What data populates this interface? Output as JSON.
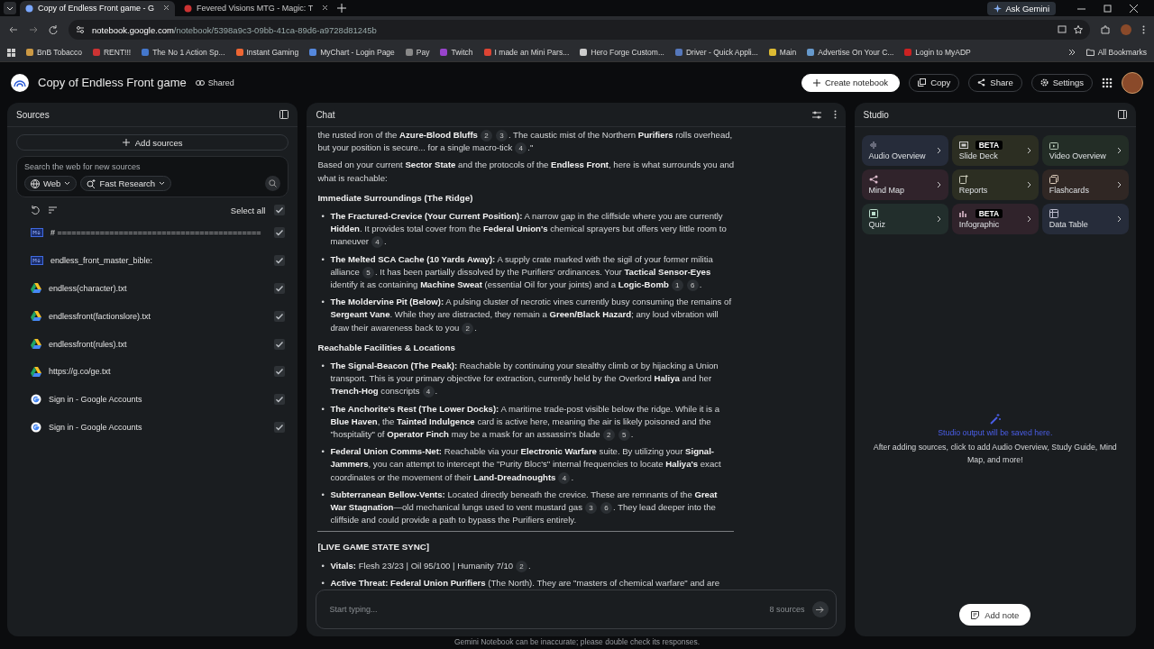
{
  "browser": {
    "tabs": [
      {
        "label": "Copy of Endless Front game - G",
        "selected": true
      },
      {
        "label": "Fevered Visions MTG - Magic: T",
        "selected": false
      }
    ],
    "ask_gemini": "Ask Gemini",
    "address": "notebook.google.com/notebook/5398a9c3-09bb-41ca-89d6-a9728d81245b",
    "bookmarks": [
      "BnB Tobacco",
      "RENT!!!",
      "The No 1 Action Sp...",
      "Instant Gaming",
      "MyChart - Login Page",
      "Pay",
      "Twitch",
      "I made an Mini Pars...",
      "Hero Forge Custom...",
      "Driver - Quick Appli...",
      "Main",
      "Advertise On Your C...",
      "Login to MyADP"
    ],
    "all_bookmarks": "All Bookmarks"
  },
  "header": {
    "title": "Copy of Endless Front game",
    "shared": "Shared",
    "actions": [
      "Create notebook",
      "Copy",
      "Share",
      "Settings"
    ]
  },
  "sources": {
    "title": "Sources",
    "add": "Add sources",
    "search_placeholder": "Search the web for new sources",
    "web": "Web",
    "research": "Fast Research",
    "select_all": {
      "label": "Select all",
      "checked": true
    },
    "items": [
      {
        "kind": "markdown",
        "name": "# ===========================================",
        "checked": true
      },
      {
        "kind": "markdown",
        "name": "endless_front_master_bible:",
        "checked": true
      },
      {
        "kind": "drive",
        "name": "endless(character).txt",
        "checked": true
      },
      {
        "kind": "drive",
        "name": "endlessfront(factionslore).txt",
        "checked": true
      },
      {
        "kind": "drive",
        "name": "endlessfront(rules).txt",
        "checked": true
      },
      {
        "kind": "drive",
        "name": "https://g.co/ge.txt",
        "checked": true
      },
      {
        "kind": "web",
        "name": "Sign in - Google Accounts",
        "checked": true
      },
      {
        "kind": "web",
        "name": "Sign in - Google Accounts",
        "checked": true
      }
    ]
  },
  "chat": {
    "title": "Chat",
    "blocks": [
      {
        "kind": "para",
        "segments": [
          {
            "text": "the rusted iron of the **Azure-Blood Bluffs**"
          },
          {
            "cite": "2"
          },
          {
            "cite": "3"
          },
          {
            "text": ". The caustic mist of the Northern **Purifiers** rolls overhead, but your position is secure... for a single macro-tick"
          },
          {
            "cite": "4"
          },
          {
            "text": ".\""
          }
        ]
      },
      {
        "kind": "para",
        "segments": [
          {
            "text": "Based on your current **Sector State** and the protocols of the **Endless Front**, here is what surrounds you and what is reachable:"
          }
        ]
      },
      {
        "kind": "heading",
        "text": "Immediate Surroundings (The Ridge)"
      },
      {
        "kind": "bullets",
        "marker": "•",
        "items": [
          [
            {
              "text": "**The Fractured-Crevice (Your Current Position):** A narrow gap in the cliffside where you are currently **Hidden**. It provides total cover from the **Federal Union's** chemical sprayers but offers very little room to maneuver"
            },
            {
              "cite": "4"
            },
            {
              "text": "."
            }
          ],
          [
            {
              "text": "**The Melted SCA Cache (10 Yards Away):** A supply crate marked with the sigil of your former militia alliance"
            },
            {
              "cite": "5"
            },
            {
              "text": ". It has been partially dissolved by the Purifiers' ordinances. Your **Tactical Sensor-Eyes** identify it as containing **Machine Sweat** (essential Oil for your joints) and a **Logic-Bomb**"
            },
            {
              "cite": "1"
            },
            {
              "cite": "6"
            },
            {
              "text": "."
            }
          ],
          [
            {
              "text": "**The Moldervine Pit (Below):** A pulsing cluster of necrotic vines currently busy consuming the remains of **Sergeant Vane**. While they are distracted, they remain a **Green/Black Hazard**; any loud vibration will draw their awareness back to you"
            },
            {
              "cite": "2"
            },
            {
              "text": "."
            }
          ]
        ]
      },
      {
        "kind": "heading",
        "text": "Reachable Facilities & Locations"
      },
      {
        "kind": "bullets",
        "marker": "•",
        "items": [
          [
            {
              "text": "**The Signal-Beacon (The Peak):** Reachable by continuing your stealthy climb or by hijacking a Union transport. This is your primary objective for extraction, currently held by the Overlord **Haliya** and her **Trench-Hog** conscripts"
            },
            {
              "cite": "4"
            },
            {
              "text": "."
            }
          ],
          [
            {
              "text": "**The Anchorite's Rest (The Lower Docks):** A maritime trade-post visible below the ridge. While it is a **Blue Haven**, the **Tainted Indulgence** card is active here, meaning the air is likely poisoned and the \"hospitality\" of **Operator Finch** may be a mask for an assassin's blade"
            },
            {
              "cite": "2"
            },
            {
              "cite": "5"
            },
            {
              "text": "."
            }
          ],
          [
            {
              "text": "**Federal Union Comms-Net:** Reachable via your **Electronic Warfare** suite. By utilizing your **Signal-Jammers**, you can attempt to intercept the \"Purity Bloc's\" internal frequencies to locate **Haliya's** exact coordinates or the movement of their **Land-Dreadnoughts**"
            },
            {
              "cite": "4"
            },
            {
              "text": "."
            }
          ],
          [
            {
              "text": "**Subterranean Bellow-Vents:** Located directly beneath the crevice. These are remnants of the **Great War Stagnation**—old mechanical lungs used to vent mustard gas"
            },
            {
              "cite": "3"
            },
            {
              "cite": "6"
            },
            {
              "text": ". They lead deeper into the cliffside and could provide a path to bypass the Purifiers entirely."
            }
          ]
        ]
      },
      {
        "kind": "rule"
      },
      {
        "kind": "heading",
        "text": "[LIVE GAME STATE SYNC]"
      },
      {
        "kind": "bullets",
        "marker": "•",
        "items": [
          [
            {
              "text": "**Vitals:** Flesh 23/23 | Oil 95/100 | Humanity 7/10"
            },
            {
              "cite": "2"
            },
            {
              "text": "."
            }
          ],
          [
            {
              "text": "**Active Threat: Federal Union Purifiers** (The North). They are \"masters of chemical warfare\" and are"
            }
          ]
        ]
      }
    ],
    "input_placeholder": "Start typing...",
    "source_count": "8 sources",
    "disclaimer": "Gemini Notebook can be inaccurate; please double check its responses."
  },
  "studio": {
    "title": "Studio",
    "tiles": [
      {
        "label": "Audio Overview",
        "color": "#262c3a",
        "kind": "audio"
      },
      {
        "label": "Slide Deck",
        "badge": "BETA",
        "color": "#2c2e22",
        "kind": "slides"
      },
      {
        "label": "Video Overview",
        "color": "#232d26",
        "kind": "video"
      },
      {
        "label": "Mind Map",
        "color": "#30232b",
        "kind": "mindmap"
      },
      {
        "label": "Reports",
        "color": "#2c2e22",
        "kind": "reports"
      },
      {
        "label": "Flashcards",
        "color": "#302724",
        "kind": "flashcards"
      },
      {
        "label": "Quiz",
        "color": "#222e2c",
        "kind": "quiz"
      },
      {
        "label": "Infographic",
        "badge": "BETA",
        "color": "#30232b",
        "kind": "infographic"
      },
      {
        "label": "Data Table",
        "color": "#262c3a",
        "kind": "table"
      }
    ],
    "empty_title": "Studio output will be saved here.",
    "empty_text": "After adding sources, click to add Audio Overview, Study Guide, Mind Map, and more!",
    "add_note": "Add note"
  }
}
